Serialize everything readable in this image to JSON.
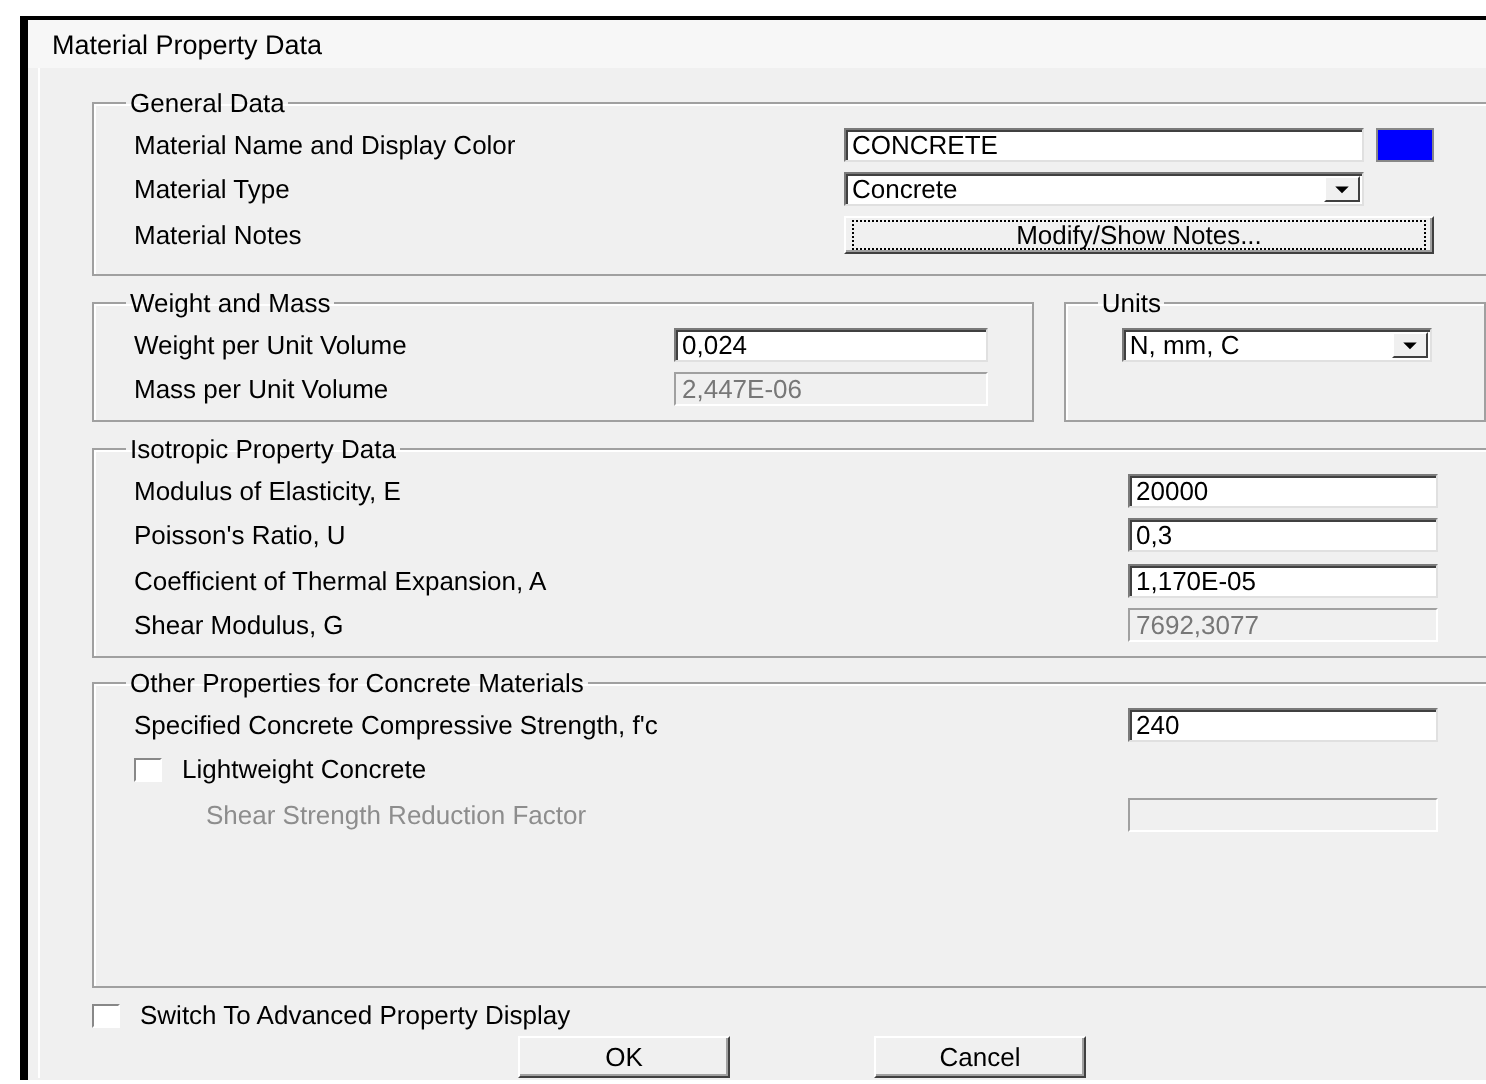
{
  "window": {
    "title": "Material Property Data"
  },
  "general_data": {
    "title": "General Data",
    "rows": [
      {
        "kind": "text",
        "label": "Material Name and Display Color",
        "value": "CONCRETE",
        "color": "#0000ff",
        "disabled": false
      },
      {
        "kind": "dropdown",
        "label": "Material Type",
        "value": "Concrete"
      },
      {
        "kind": "button",
        "label": "Material Notes",
        "value": "Modify/Show Notes..."
      }
    ]
  },
  "weight_and_mass": {
    "title": "Weight and Mass",
    "rows": [
      {
        "kind": "text",
        "label": "Weight per Unit Volume",
        "value": "0,024",
        "disabled": false
      },
      {
        "kind": "text",
        "label": "Mass per Unit Volume",
        "value": "2,447E-06",
        "disabled": true
      }
    ]
  },
  "units": {
    "title": "Units",
    "value": "N, mm, C"
  },
  "isotropic_property_data": {
    "title": "Isotropic Property Data",
    "rows": [
      {
        "kind": "text",
        "label": "Modulus of Elasticity,  E",
        "value": "20000",
        "disabled": false
      },
      {
        "kind": "text",
        "label": "Poisson's Ratio,  U",
        "value": "0,3",
        "disabled": false
      },
      {
        "kind": "text",
        "label": "Coefficient of Thermal Expansion,  A",
        "value": "1,170E-05",
        "disabled": false
      },
      {
        "kind": "text",
        "label": "Shear Modulus,  G",
        "value": "7692,3077",
        "disabled": true
      }
    ]
  },
  "other_properties": {
    "title": "Other Properties for Concrete Materials",
    "rows": [
      {
        "kind": "text",
        "label": "Specified Concrete Compressive Strength, f'c",
        "value": "240",
        "disabled": false
      },
      {
        "kind": "checkbox",
        "label": "Lightweight Concrete",
        "checked": false,
        "disabled": false
      },
      {
        "kind": "text",
        "label": "Shear Strength Reduction Factor",
        "disabled": true
      }
    ]
  },
  "advanced_display": {
    "label": "Switch To Advanced Property Display",
    "checked": false
  },
  "buttons": [
    "OK",
    "Cancel"
  ]
}
